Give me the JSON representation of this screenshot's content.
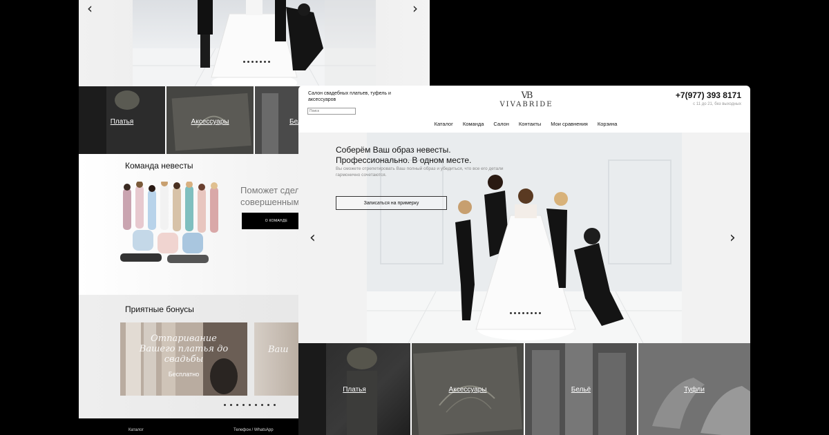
{
  "back": {
    "categories": [
      "Платья",
      "Аксессуары",
      "Бел"
    ],
    "team_title": "Команда невесты",
    "team_text_line1": "Поможет сдела",
    "team_text_line2": "совершенным..",
    "team_button": "О КОМАНДЕ",
    "bonus_title": "Приятные бонусы",
    "bonus_card_big": "Отпаривание Вашего платья до свадьбы",
    "bonus_card_small": "Бесплатно",
    "bonus_card2_big": "Ваш",
    "footer_catalog": "Каталог",
    "footer_phone": "Телефон / WhatsApp"
  },
  "front": {
    "tagline": "Салон свадебных платьев, туфель и аксессуаров",
    "search_placeholder": "Поиск",
    "logo_mark": "VB",
    "logo_text": "VIVABRIDE",
    "phone": "+7(977) 393 8171",
    "hours": "с 11 до 21, без выходных",
    "nav": [
      "Каталог",
      "Команда",
      "Салон",
      "Контакты",
      "Мои сравнения",
      "Корзина"
    ],
    "hero_title_line1": "Соберём Ваш образ невесты.",
    "hero_title_line2": "Профессионально. В одном месте.",
    "hero_subtitle": "Вы сможете отрепетировать Ваш полный образ и убедиться, что все его детали гармонично сочетаются.",
    "hero_button": "Записаться на примерку",
    "arrow_prev": "‹",
    "arrow_next": "›",
    "categories": [
      "Платья",
      "Аксессуары",
      "Бельё",
      "Туфли"
    ]
  }
}
